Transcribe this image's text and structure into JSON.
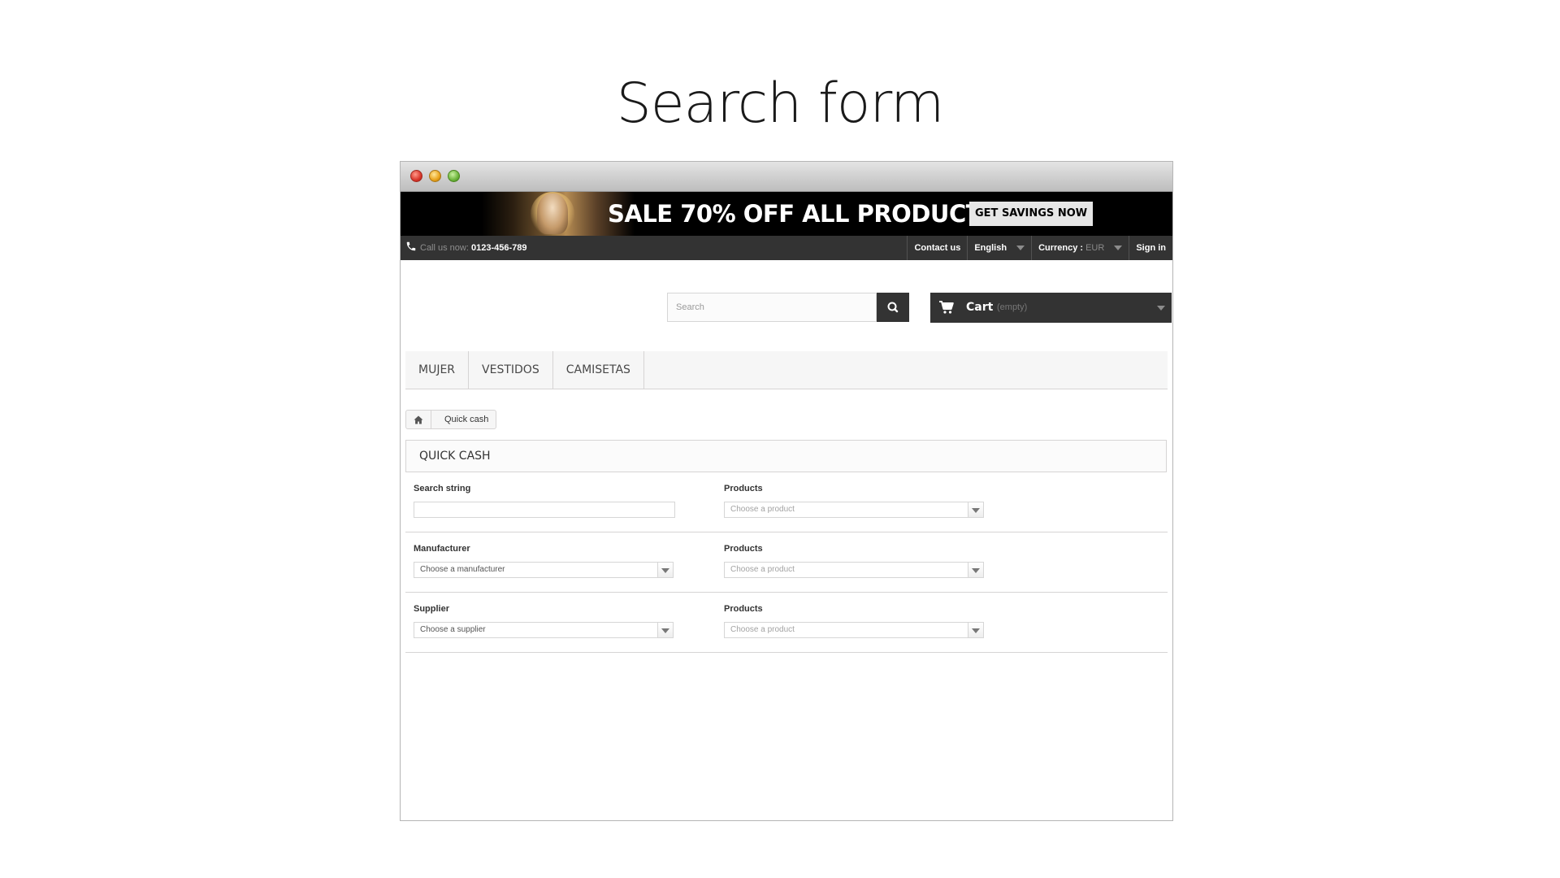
{
  "page": {
    "title": "Search form"
  },
  "banner": {
    "headline": "SALE 70% OFF ALL PRODUCTS",
    "button": "GET SAVINGS NOW"
  },
  "topbar": {
    "call_label": "Call us now:",
    "phone": "0123-456-789",
    "contact": "Contact us",
    "language": "English",
    "currency_label": "Currency :",
    "currency_value": "EUR",
    "signin": "Sign in"
  },
  "search": {
    "placeholder": "Search"
  },
  "cart": {
    "label": "Cart",
    "status": "(empty)"
  },
  "menu": {
    "items": [
      "MUJER",
      "VESTIDOS",
      "CAMISETAS"
    ]
  },
  "breadcrumb": {
    "current": "Quick cash"
  },
  "panel": {
    "title": "QUICK CASH"
  },
  "form": {
    "rows": [
      {
        "left_label": "Search string",
        "left_value": "",
        "right_label": "Products",
        "right_value": "Choose a product"
      },
      {
        "left_label": "Manufacturer",
        "left_value": "Choose a manufacturer",
        "right_label": "Products",
        "right_value": "Choose a product"
      },
      {
        "left_label": "Supplier",
        "left_value": "Choose a supplier",
        "right_label": "Products",
        "right_value": "Choose a product"
      }
    ]
  },
  "colors": {
    "dark_bar": "#333333",
    "banner_bg": "#000000",
    "menu_bg": "#f6f6f6",
    "border": "#d6d4d4"
  },
  "icons": [
    "phone-icon",
    "search-icon",
    "cart-icon",
    "home-icon",
    "chevron-down-icon"
  ]
}
